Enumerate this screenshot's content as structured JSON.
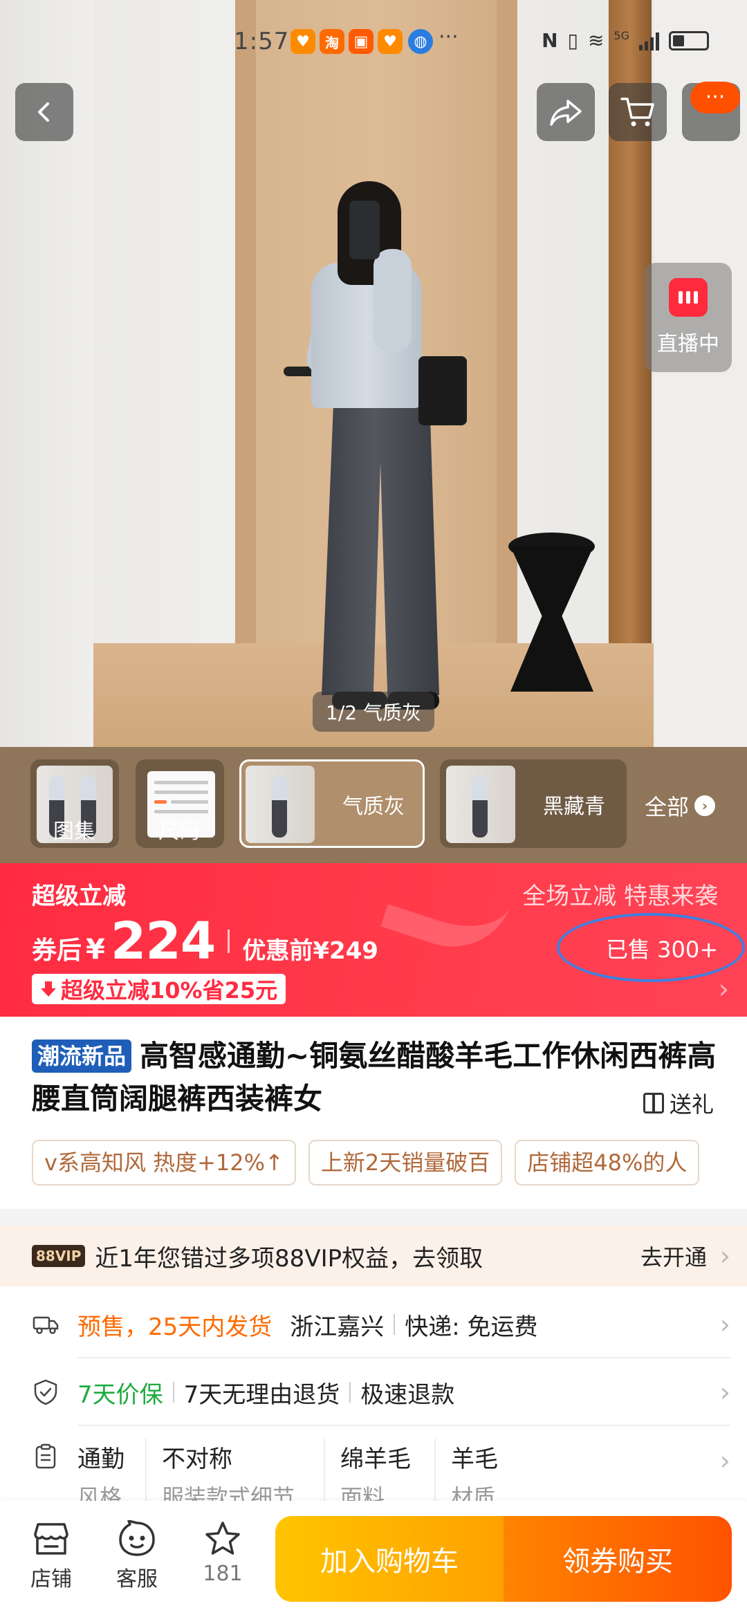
{
  "status_bar": {
    "time": "1:57",
    "app_icons": [
      "heart-icon",
      "taobao-icon",
      "red-packet-icon",
      "heart-icon",
      "browser-icon"
    ],
    "more": "···",
    "network": "5G"
  },
  "top_actions": {
    "more_pill": "···"
  },
  "live": {
    "label": "直播中"
  },
  "image_counter": "1/2 气质灰",
  "thumbnails": [
    {
      "label": "图集"
    },
    {
      "label": "尺码"
    },
    {
      "label": "气质灰",
      "active": true
    },
    {
      "label": "黑藏青"
    }
  ],
  "all_link": "全部",
  "promo": {
    "title": "超级立减",
    "slogan": "全场立减 特惠来袭",
    "price_prefix": "券后",
    "currency": "¥",
    "price": "224",
    "original_price": "优惠前¥249",
    "sold": "已售 300+",
    "tag": "超级立减10%省25元",
    "colors": {
      "banner": "#ff2b41",
      "highlight_circle": "#3f7fe0"
    }
  },
  "product": {
    "badge": "潮流新品",
    "title": "高智感通勤~铜氨丝醋酸羊毛工作休闲西裤高腰直筒阔腿裤西装裤女",
    "gift": "送礼"
  },
  "chips": [
    "v系高知风 热度+12%",
    "上新2天销量破百",
    "店铺超48%的人"
  ],
  "chip_arrow": "↑",
  "vip": {
    "badge": "88VIP",
    "text": "近1年您错过多项88VIP权益，去领取",
    "cta": "去开通"
  },
  "shipping": {
    "presale": "预售，25天内发货",
    "origin": "浙江嘉兴",
    "express": "快递: 免运费"
  },
  "guarantee": {
    "price_protect": "7天价保",
    "return": "7天无理由退货",
    "refund": "极速退款"
  },
  "attributes": [
    {
      "value": "通勤",
      "name": "风格"
    },
    {
      "value": "不对称",
      "name": "服装款式细节"
    },
    {
      "value": "绵羊毛",
      "name": "面料"
    },
    {
      "value": "羊毛",
      "name": "材质"
    }
  ],
  "bottom_bar": {
    "shop": "店铺",
    "service": "客服",
    "favorites": "181",
    "add_to_cart": "加入购物车",
    "buy": "领券购买",
    "colors": {
      "cart": "#ffb000",
      "buy": "#ff6a00"
    }
  }
}
